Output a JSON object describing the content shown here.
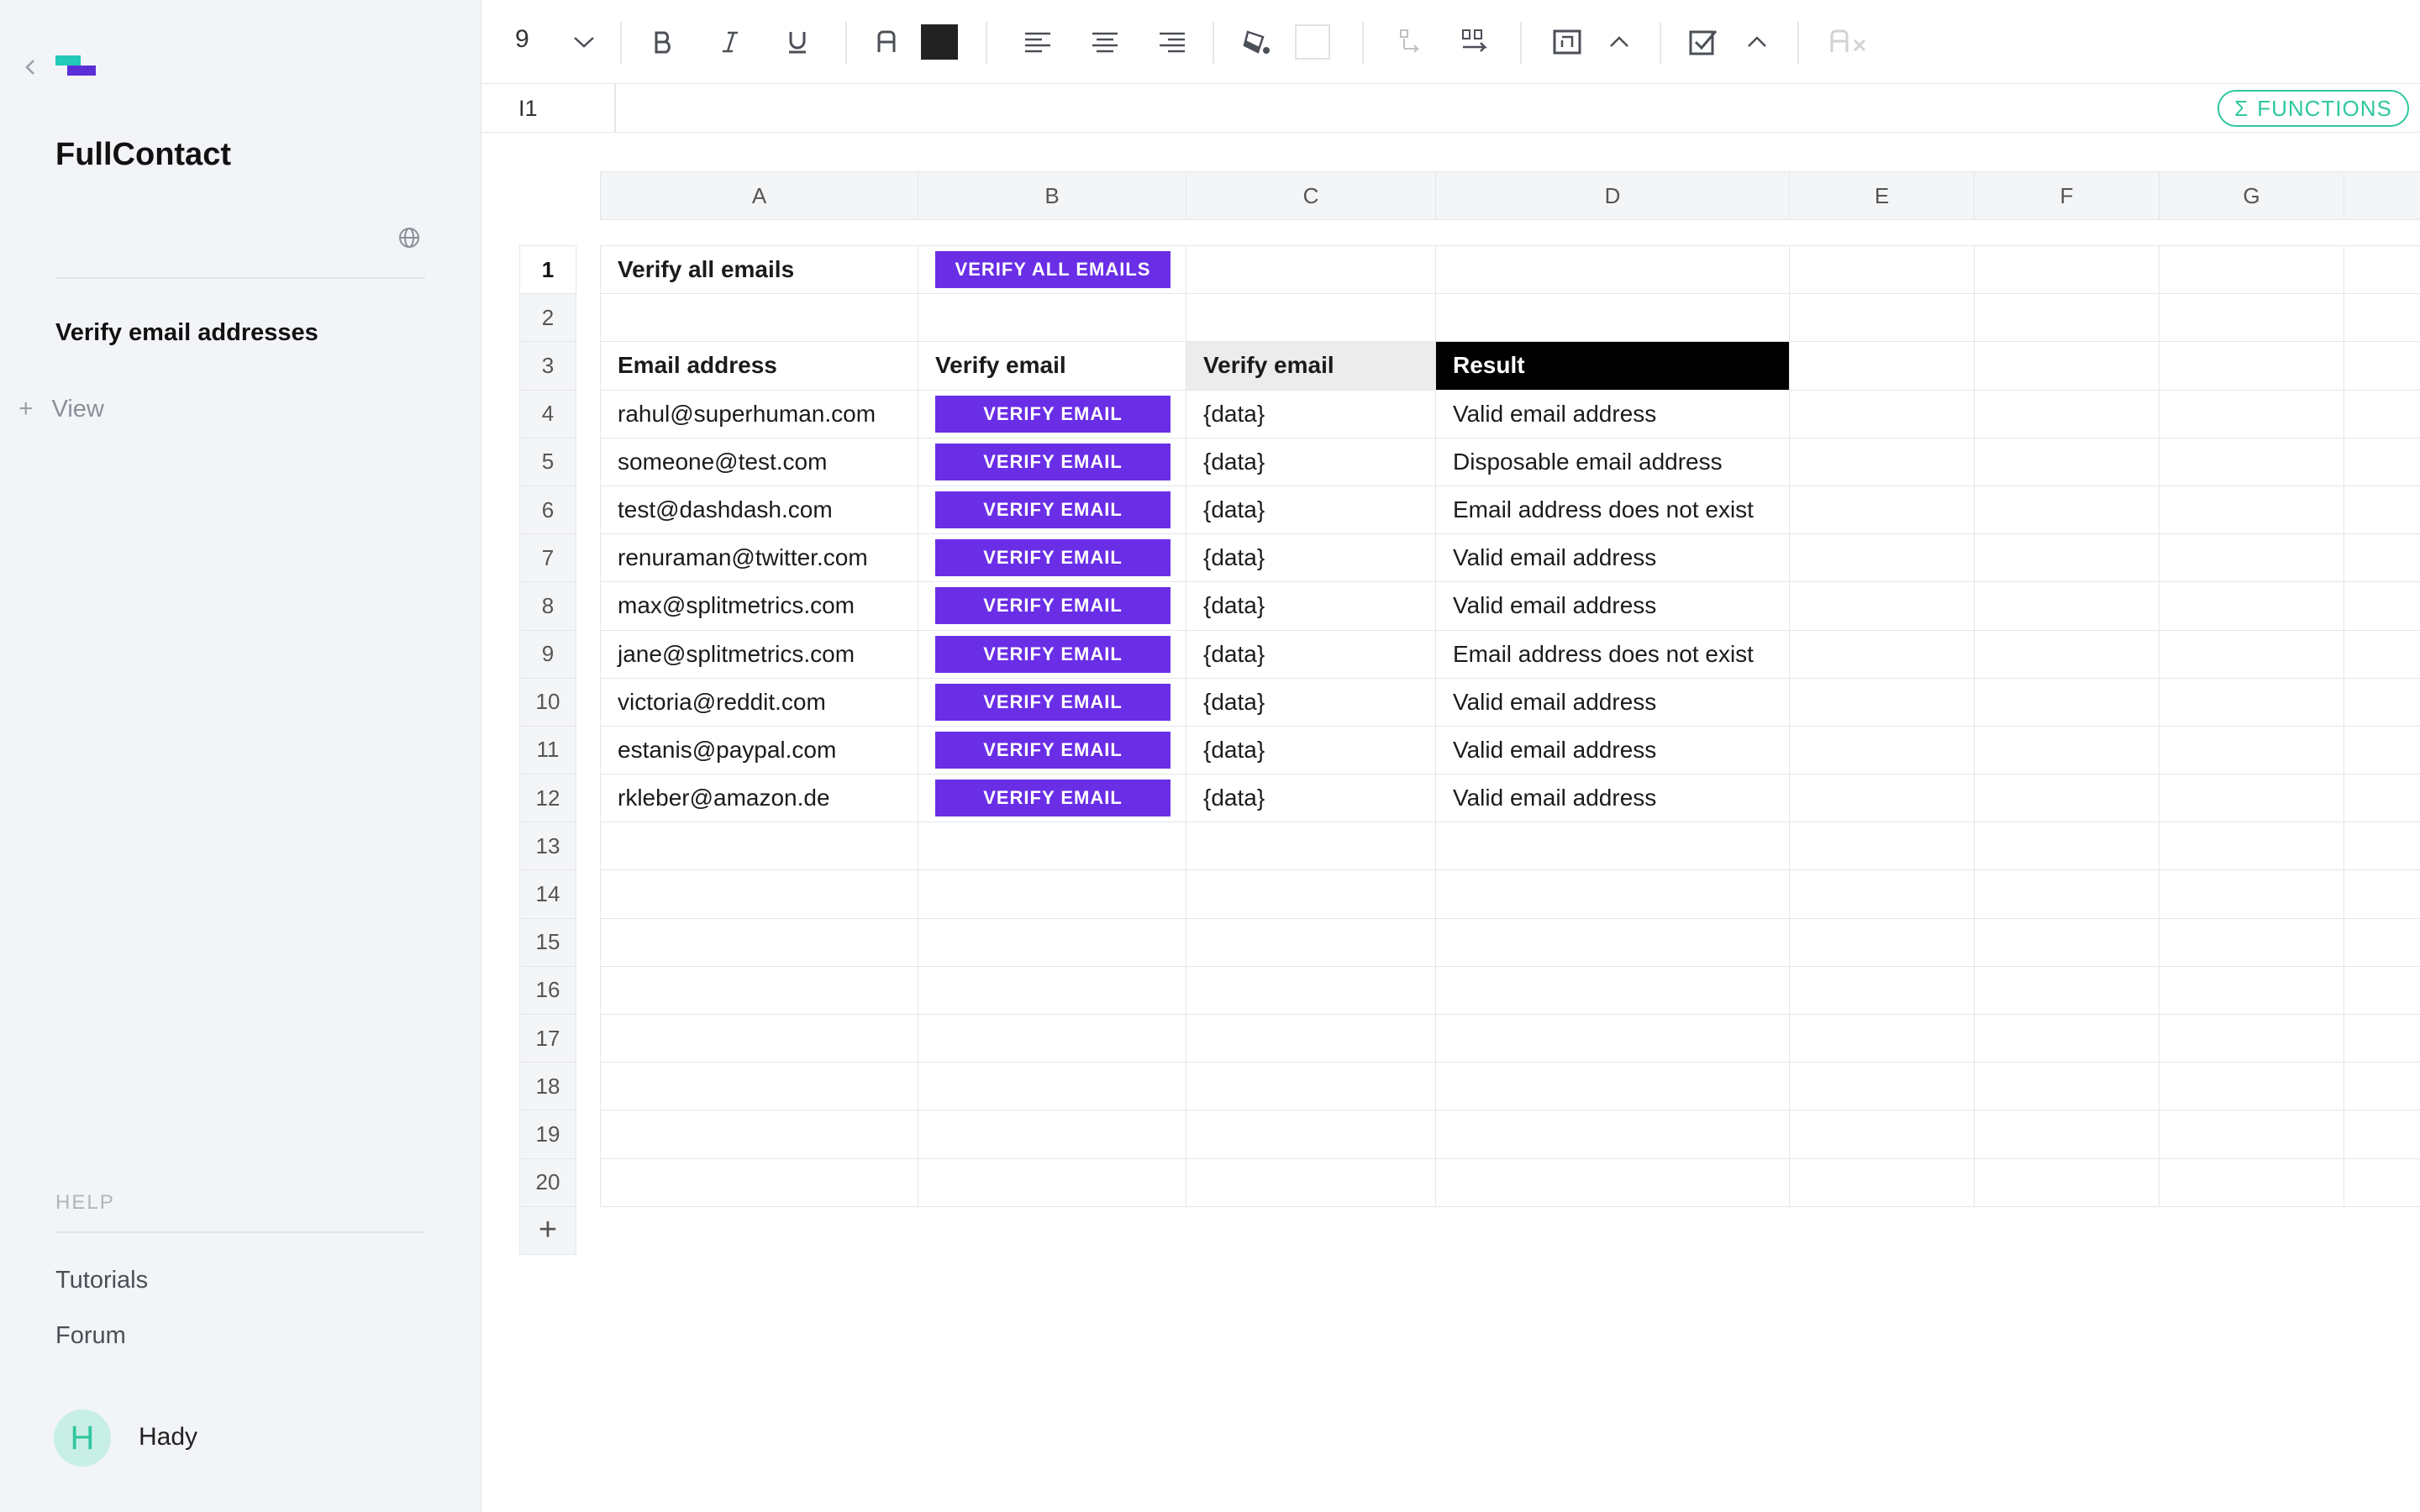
{
  "sidebar": {
    "app_title": "FullContact",
    "page_item": "Verify email addresses",
    "add_view_label": "View",
    "help_label": "HELP",
    "help_links": [
      "Tutorials",
      "Forum"
    ],
    "user": {
      "initial": "H",
      "name": "Hady"
    }
  },
  "toolbar": {
    "font_size": "9",
    "text_color": "#222222",
    "fill_color": "#ffffff"
  },
  "formula_bar": {
    "cell_ref": "I1",
    "functions_label": "FUNCTIONS"
  },
  "sheet": {
    "columns": [
      "A",
      "B",
      "C",
      "D",
      "E",
      "F",
      "G",
      ""
    ],
    "rows": [
      "1",
      "2",
      "3",
      "4",
      "5",
      "6",
      "7",
      "8",
      "9",
      "10",
      "11",
      "12",
      "13",
      "14",
      "15",
      "16",
      "17",
      "18",
      "19",
      "20"
    ],
    "r1": {
      "a": "Verify all emails",
      "b_button": "VERIFY ALL EMAILS"
    },
    "r3": {
      "a": "Email address",
      "b": "Verify email",
      "c": "Verify email",
      "d": "Result"
    },
    "data_rows": [
      {
        "email": "rahul@superhuman.com",
        "button": "VERIFY EMAIL",
        "data": "{data}",
        "result": "Valid email address"
      },
      {
        "email": "someone@test.com",
        "button": "VERIFY EMAIL",
        "data": "{data}",
        "result": "Disposable email address"
      },
      {
        "email": "test@dashdash.com",
        "button": "VERIFY EMAIL",
        "data": "{data}",
        "result": "Email address does not exist"
      },
      {
        "email": "renuraman@twitter.com",
        "button": "VERIFY EMAIL",
        "data": "{data}",
        "result": "Valid email address"
      },
      {
        "email": "max@splitmetrics.com",
        "button": "VERIFY EMAIL",
        "data": "{data}",
        "result": "Valid email address"
      },
      {
        "email": "jane@splitmetrics.com",
        "button": "VERIFY EMAIL",
        "data": "{data}",
        "result": "Email address does not exist"
      },
      {
        "email": "victoria@reddit.com",
        "button": "VERIFY EMAIL",
        "data": "{data}",
        "result": "Valid email address"
      },
      {
        "email": "estanis@paypal.com",
        "button": "VERIFY EMAIL",
        "data": "{data}",
        "result": "Valid email address"
      },
      {
        "email": "rkleber@amazon.de",
        "button": "VERIFY EMAIL",
        "data": "{data}",
        "result": "Valid email address"
      }
    ]
  },
  "colors": {
    "accent": "#6a2ee6",
    "teal": "#2fc79f"
  }
}
